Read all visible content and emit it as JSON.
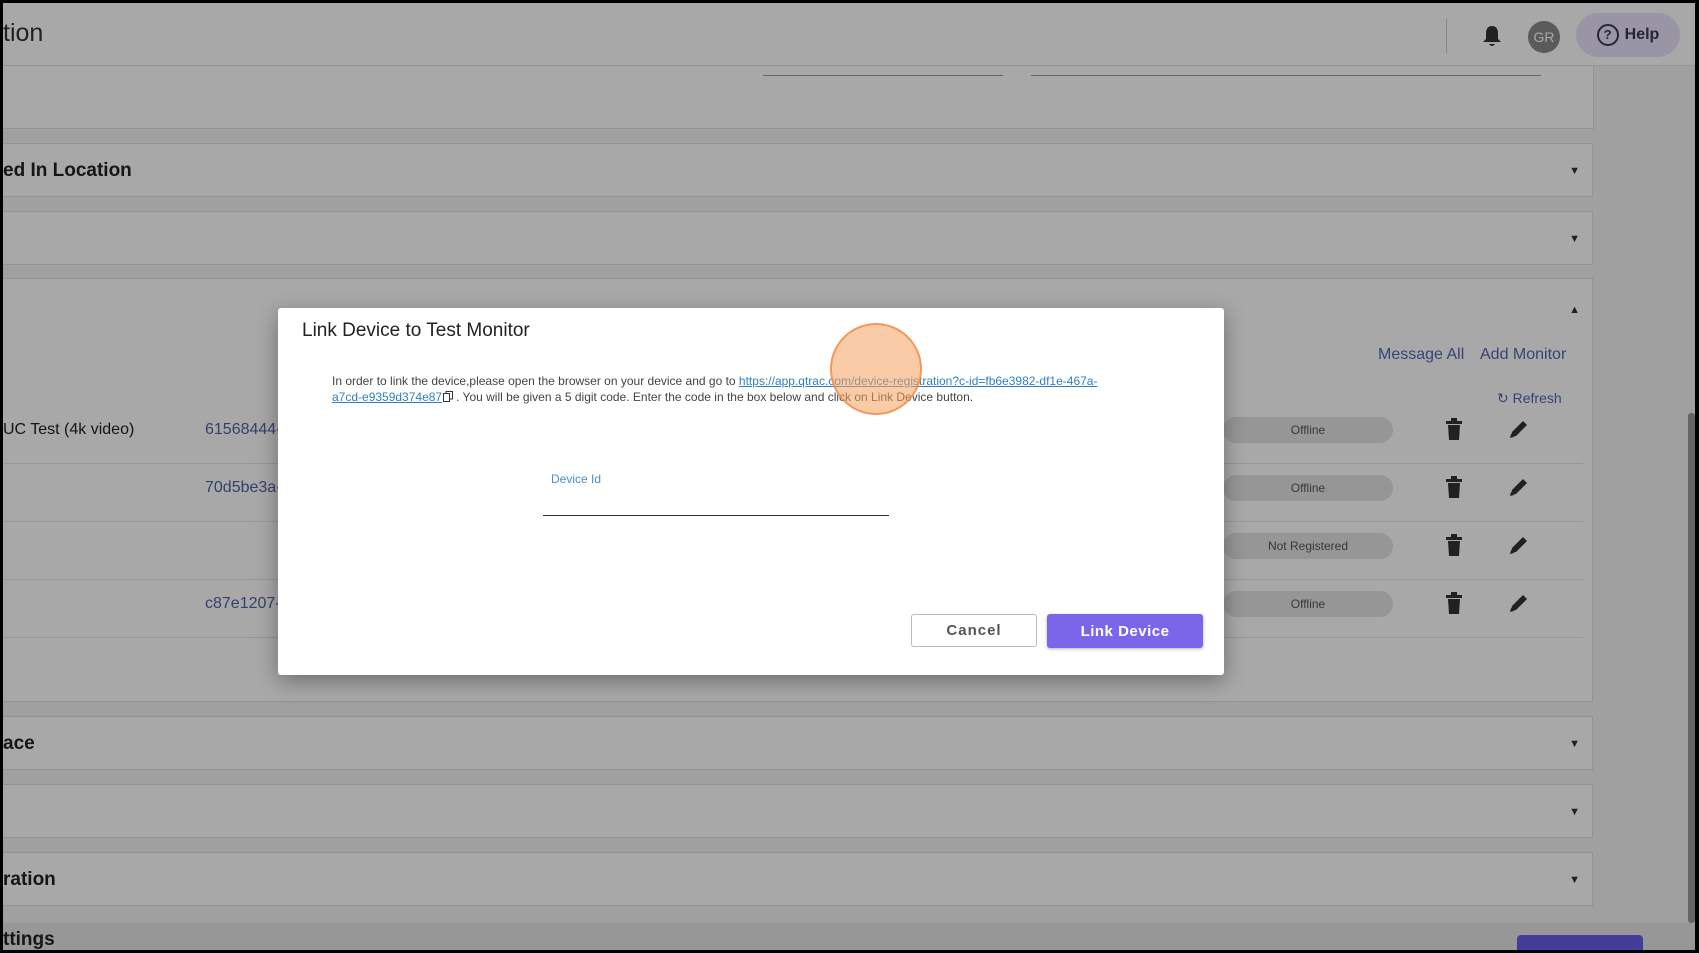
{
  "header": {
    "title": "tion",
    "avatar_initials": "GR",
    "help_label": "Help"
  },
  "sections": {
    "located_in_location": "ed In Location",
    "workspace": "ace",
    "configuration": "ration",
    "settings": "ttings"
  },
  "monitors": {
    "message_all": "Message All",
    "add_monitor": "Add Monitor",
    "refresh": "Refresh",
    "rows": [
      {
        "name": "UC Test (4k video)",
        "id": "61568444-",
        "status": "Offline"
      },
      {
        "name": "",
        "id": "70d5be3a-",
        "status": "Offline"
      },
      {
        "name": "",
        "id": "",
        "status": "Not Registered"
      },
      {
        "name": "",
        "id": "c87e1207-",
        "status": "Offline"
      }
    ]
  },
  "modal": {
    "title": "Link Device to Test Monitor",
    "text_before": "In order to link the device,please open the browser on your device and go to ",
    "url": "https://app.qtrac.com/device-registration?c-id=fb6e3982-df1e-467a-a7cd-e9359d374e87",
    "text_after": ". You will be given a 5 digit code. Enter the code in the box below and click on Link Device button.",
    "field_label": "Device Id",
    "field_value": "",
    "cancel_label": "Cancel",
    "link_label": "Link Device"
  },
  "colors": {
    "accent": "#7b66ea",
    "link": "#2f7fc0",
    "overlay": "rgba(0,0,0,0.34)"
  },
  "icons": {
    "notification": "bell-icon",
    "help": "question-circle-icon",
    "refresh": "refresh-icon",
    "delete": "trash-icon",
    "edit": "pencil-icon",
    "copy": "copy-icon",
    "expand": "caret-down-icon",
    "collapse": "caret-up-icon"
  }
}
